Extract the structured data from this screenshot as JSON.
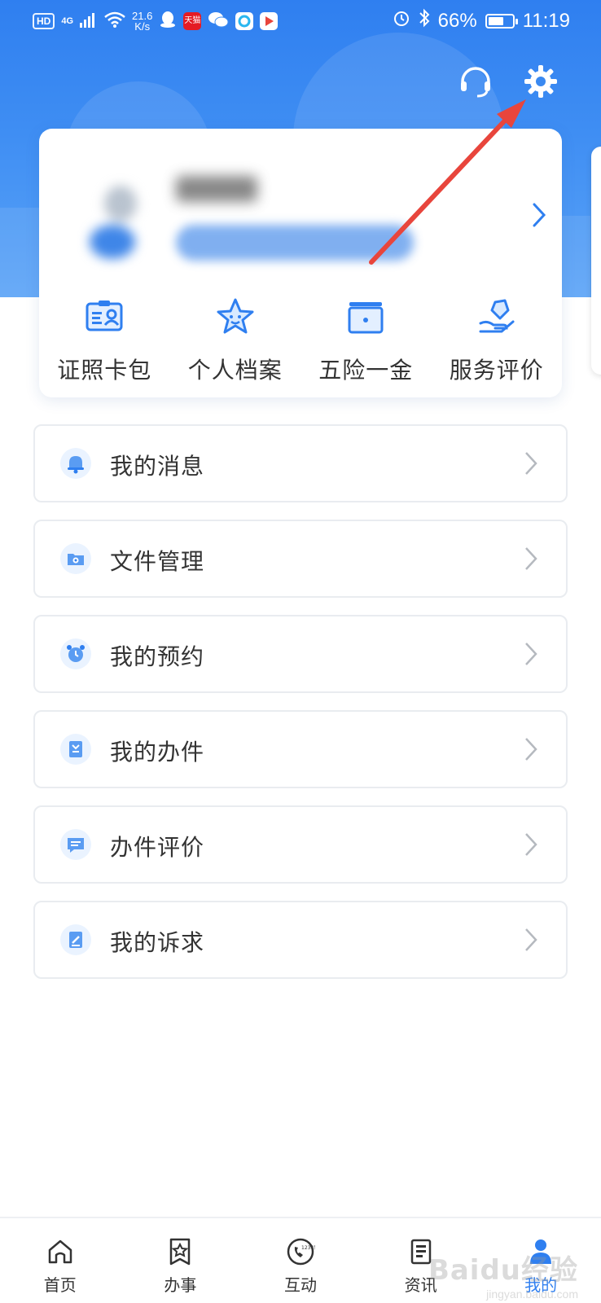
{
  "status_bar": {
    "hd": "HD",
    "network": "4G",
    "speed_value": "21.6",
    "speed_unit": "K/s",
    "app_badge": "天猫",
    "battery_percent": "66%",
    "battery_level": 0.66,
    "time": "11:19"
  },
  "header": {
    "customer_service_icon": "headset-icon",
    "settings_icon": "gear-icon"
  },
  "quick_actions": [
    {
      "label": "证照卡包",
      "icon": "id-card-icon"
    },
    {
      "label": "个人档案",
      "icon": "star-icon"
    },
    {
      "label": "五险一金",
      "icon": "wallet-icon"
    },
    {
      "label": "服务评价",
      "icon": "hand-heart-icon"
    }
  ],
  "menu": [
    {
      "label": "我的消息",
      "icon": "bell-icon"
    },
    {
      "label": "文件管理",
      "icon": "folder-gear-icon"
    },
    {
      "label": "我的预约",
      "icon": "alarm-clock-icon"
    },
    {
      "label": "我的办件",
      "icon": "document-icon"
    },
    {
      "label": "办件评价",
      "icon": "comment-icon"
    },
    {
      "label": "我的诉求",
      "icon": "edit-note-icon"
    }
  ],
  "bottom_nav": [
    {
      "label": "首页",
      "icon": "home-icon",
      "active": false
    },
    {
      "label": "办事",
      "icon": "star-doc-icon",
      "active": false
    },
    {
      "label": "互动",
      "icon": "phone-12345-icon",
      "active": false,
      "icon_text": "12345"
    },
    {
      "label": "资讯",
      "icon": "news-icon",
      "active": false
    },
    {
      "label": "我的",
      "icon": "person-icon",
      "active": true
    }
  ],
  "watermark": {
    "main": "Baidu经验",
    "sub": "jingyan.baidu.com"
  },
  "colors": {
    "primary": "#2f7ff0",
    "arrow": "#e8453c",
    "border": "#e9ecf0"
  }
}
